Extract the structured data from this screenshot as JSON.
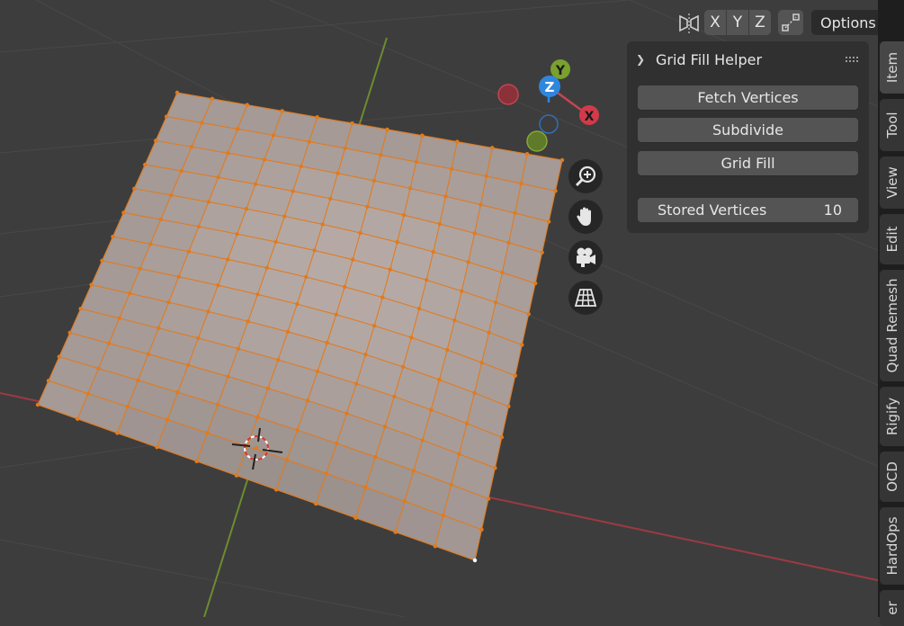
{
  "header": {
    "axes": [
      "X",
      "Y",
      "Z"
    ],
    "options_label": "Options"
  },
  "gizmo": {
    "y_label": "Y",
    "z_label": "Z",
    "x_label": "X"
  },
  "panel": {
    "title": "Grid Fill Helper",
    "buttons": [
      "Fetch Vertices",
      "Subdivide",
      "Grid Fill"
    ],
    "stored_label": "Stored Vertices",
    "stored_value": "10"
  },
  "tabs": [
    "Item",
    "Tool",
    "View",
    "Edit",
    "Quad Remesh",
    "Rigify",
    "OCD",
    "HardOps",
    "er"
  ],
  "colors": {
    "background": "#3d3d3d",
    "mesh_face": "#b3a7a3",
    "mesh_edge": "#e07b1f",
    "x_axis": "#c4464f",
    "y_axis": "#84a83a",
    "z_axis": "#2f86dd"
  }
}
